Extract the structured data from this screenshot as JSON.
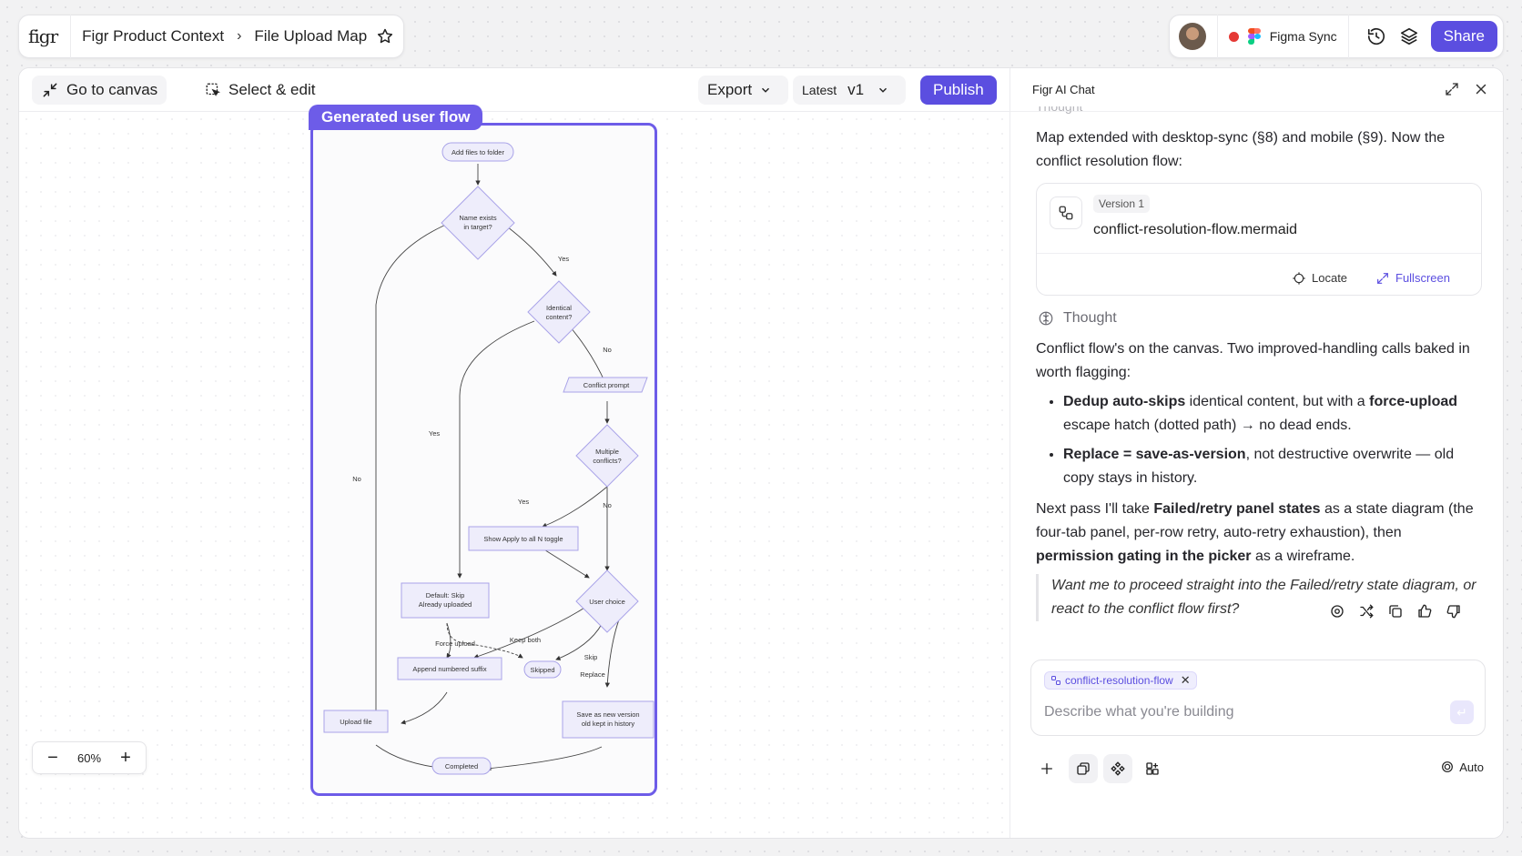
{
  "app": {
    "logo": "figr"
  },
  "breadcrumb": {
    "project": "Figr Product Context",
    "separator": "›",
    "page": "File Upload Map"
  },
  "header_right": {
    "sync_label": "Figma Sync",
    "share_label": "Share"
  },
  "toolbar": {
    "go_to_canvas": "Go to canvas",
    "select_edit": "Select & edit",
    "export": "Export",
    "version_prefix": "Latest",
    "version": "v1",
    "publish": "Publish"
  },
  "canvas": {
    "frame_label": "Generated user flow",
    "zoom": "60%",
    "flow_nodes": {
      "add_files": "Add files to folder",
      "name_exists_1": "Name exists",
      "name_exists_2": "in target?",
      "identical_1": "Identical",
      "identical_2": "content?",
      "conflict_prompt": "Conflict prompt",
      "multiple_1": "Multiple",
      "multiple_2": "conflicts?",
      "show_apply": "Show Apply to all N toggle",
      "user_choice": "User choice",
      "default_skip_1": "Default: Skip",
      "default_skip_2": "Already uploaded",
      "append": "Append numbered suffix",
      "skipped": "Skipped",
      "upload_file": "Upload file",
      "save_new_1": "Save as new version",
      "save_new_2": "old kept in history",
      "completed": "Completed"
    },
    "flow_edges": {
      "yes1": "Yes",
      "no1": "No",
      "yes2": "Yes",
      "no2": "No",
      "yes3": "Yes",
      "no3": "No",
      "force_upload": "Force upload",
      "keep_both": "Keep both",
      "skip": "Skip",
      "replace": "Replace"
    }
  },
  "chat": {
    "title": "Figr AI Chat",
    "partial_top": "Thought",
    "intro": "Map extended with desktop-sync (§8) and mobile (§9). Now the conflict resolution flow:",
    "artifact": {
      "version_tag": "Version 1",
      "file_name": "conflict-resolution-flow.mermaid",
      "locate": "Locate",
      "fullscreen": "Fullscreen"
    },
    "thought_label": "Thought",
    "para1": "Conflict flow's on the canvas. Two improved-handling calls baked in worth flagging:",
    "bullet1_bold": "Dedup auto-skips",
    "bullet1_mid": " identical content, but with a ",
    "bullet1_bold2": "force-upload",
    "bullet1_rest": " escape hatch (dotted path) → no dead ends.",
    "bullet2_bold": "Replace = save-as-version",
    "bullet2_rest": ", not destructive overwrite — old copy stays in history.",
    "para2_a": "Next pass I'll take ",
    "para2_b": "Failed/retry panel states",
    "para2_c": " as a state diagram (the four-tab panel, per-row retry, auto-retry exhaustion), then ",
    "para2_d": "permission gating in the picker",
    "para2_e": " as a wireframe.",
    "quote": "Want me to proceed straight into the Failed/retry state diagram, or react to the conflict flow first?",
    "composer": {
      "chip": "conflict-resolution-flow",
      "placeholder": "Describe what you're building",
      "mode": "Auto"
    }
  },
  "colors": {
    "accent": "#5b4ee0",
    "frame": "#6d5ce8",
    "node_fill": "#eeedfb",
    "node_stroke": "#a9a3e8"
  }
}
